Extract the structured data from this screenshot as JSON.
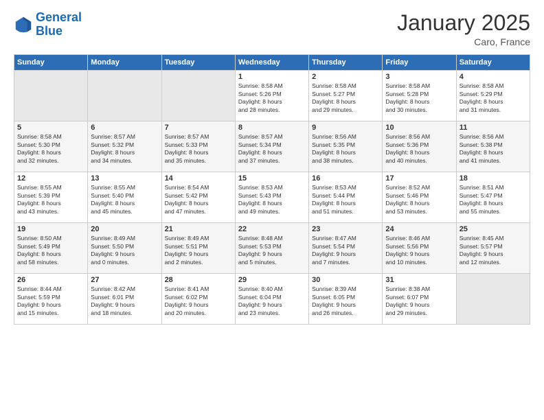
{
  "logo": {
    "line1": "General",
    "line2": "Blue"
  },
  "title": "January 2025",
  "location": "Caro, France",
  "days_of_week": [
    "Sunday",
    "Monday",
    "Tuesday",
    "Wednesday",
    "Thursday",
    "Friday",
    "Saturday"
  ],
  "weeks": [
    [
      {
        "day": "",
        "info": ""
      },
      {
        "day": "",
        "info": ""
      },
      {
        "day": "",
        "info": ""
      },
      {
        "day": "1",
        "info": "Sunrise: 8:58 AM\nSunset: 5:26 PM\nDaylight: 8 hours\nand 28 minutes."
      },
      {
        "day": "2",
        "info": "Sunrise: 8:58 AM\nSunset: 5:27 PM\nDaylight: 8 hours\nand 29 minutes."
      },
      {
        "day": "3",
        "info": "Sunrise: 8:58 AM\nSunset: 5:28 PM\nDaylight: 8 hours\nand 30 minutes."
      },
      {
        "day": "4",
        "info": "Sunrise: 8:58 AM\nSunset: 5:29 PM\nDaylight: 8 hours\nand 31 minutes."
      }
    ],
    [
      {
        "day": "5",
        "info": "Sunrise: 8:58 AM\nSunset: 5:30 PM\nDaylight: 8 hours\nand 32 minutes."
      },
      {
        "day": "6",
        "info": "Sunrise: 8:57 AM\nSunset: 5:32 PM\nDaylight: 8 hours\nand 34 minutes."
      },
      {
        "day": "7",
        "info": "Sunrise: 8:57 AM\nSunset: 5:33 PM\nDaylight: 8 hours\nand 35 minutes."
      },
      {
        "day": "8",
        "info": "Sunrise: 8:57 AM\nSunset: 5:34 PM\nDaylight: 8 hours\nand 37 minutes."
      },
      {
        "day": "9",
        "info": "Sunrise: 8:56 AM\nSunset: 5:35 PM\nDaylight: 8 hours\nand 38 minutes."
      },
      {
        "day": "10",
        "info": "Sunrise: 8:56 AM\nSunset: 5:36 PM\nDaylight: 8 hours\nand 40 minutes."
      },
      {
        "day": "11",
        "info": "Sunrise: 8:56 AM\nSunset: 5:38 PM\nDaylight: 8 hours\nand 41 minutes."
      }
    ],
    [
      {
        "day": "12",
        "info": "Sunrise: 8:55 AM\nSunset: 5:39 PM\nDaylight: 8 hours\nand 43 minutes."
      },
      {
        "day": "13",
        "info": "Sunrise: 8:55 AM\nSunset: 5:40 PM\nDaylight: 8 hours\nand 45 minutes."
      },
      {
        "day": "14",
        "info": "Sunrise: 8:54 AM\nSunset: 5:42 PM\nDaylight: 8 hours\nand 47 minutes."
      },
      {
        "day": "15",
        "info": "Sunrise: 8:53 AM\nSunset: 5:43 PM\nDaylight: 8 hours\nand 49 minutes."
      },
      {
        "day": "16",
        "info": "Sunrise: 8:53 AM\nSunset: 5:44 PM\nDaylight: 8 hours\nand 51 minutes."
      },
      {
        "day": "17",
        "info": "Sunrise: 8:52 AM\nSunset: 5:46 PM\nDaylight: 8 hours\nand 53 minutes."
      },
      {
        "day": "18",
        "info": "Sunrise: 8:51 AM\nSunset: 5:47 PM\nDaylight: 8 hours\nand 55 minutes."
      }
    ],
    [
      {
        "day": "19",
        "info": "Sunrise: 8:50 AM\nSunset: 5:49 PM\nDaylight: 8 hours\nand 58 minutes."
      },
      {
        "day": "20",
        "info": "Sunrise: 8:49 AM\nSunset: 5:50 PM\nDaylight: 9 hours\nand 0 minutes."
      },
      {
        "day": "21",
        "info": "Sunrise: 8:49 AM\nSunset: 5:51 PM\nDaylight: 9 hours\nand 2 minutes."
      },
      {
        "day": "22",
        "info": "Sunrise: 8:48 AM\nSunset: 5:53 PM\nDaylight: 9 hours\nand 5 minutes."
      },
      {
        "day": "23",
        "info": "Sunrise: 8:47 AM\nSunset: 5:54 PM\nDaylight: 9 hours\nand 7 minutes."
      },
      {
        "day": "24",
        "info": "Sunrise: 8:46 AM\nSunset: 5:56 PM\nDaylight: 9 hours\nand 10 minutes."
      },
      {
        "day": "25",
        "info": "Sunrise: 8:45 AM\nSunset: 5:57 PM\nDaylight: 9 hours\nand 12 minutes."
      }
    ],
    [
      {
        "day": "26",
        "info": "Sunrise: 8:44 AM\nSunset: 5:59 PM\nDaylight: 9 hours\nand 15 minutes."
      },
      {
        "day": "27",
        "info": "Sunrise: 8:42 AM\nSunset: 6:01 PM\nDaylight: 9 hours\nand 18 minutes."
      },
      {
        "day": "28",
        "info": "Sunrise: 8:41 AM\nSunset: 6:02 PM\nDaylight: 9 hours\nand 20 minutes."
      },
      {
        "day": "29",
        "info": "Sunrise: 8:40 AM\nSunset: 6:04 PM\nDaylight: 9 hours\nand 23 minutes."
      },
      {
        "day": "30",
        "info": "Sunrise: 8:39 AM\nSunset: 6:05 PM\nDaylight: 9 hours\nand 26 minutes."
      },
      {
        "day": "31",
        "info": "Sunrise: 8:38 AM\nSunset: 6:07 PM\nDaylight: 9 hours\nand 29 minutes."
      },
      {
        "day": "",
        "info": ""
      }
    ]
  ]
}
